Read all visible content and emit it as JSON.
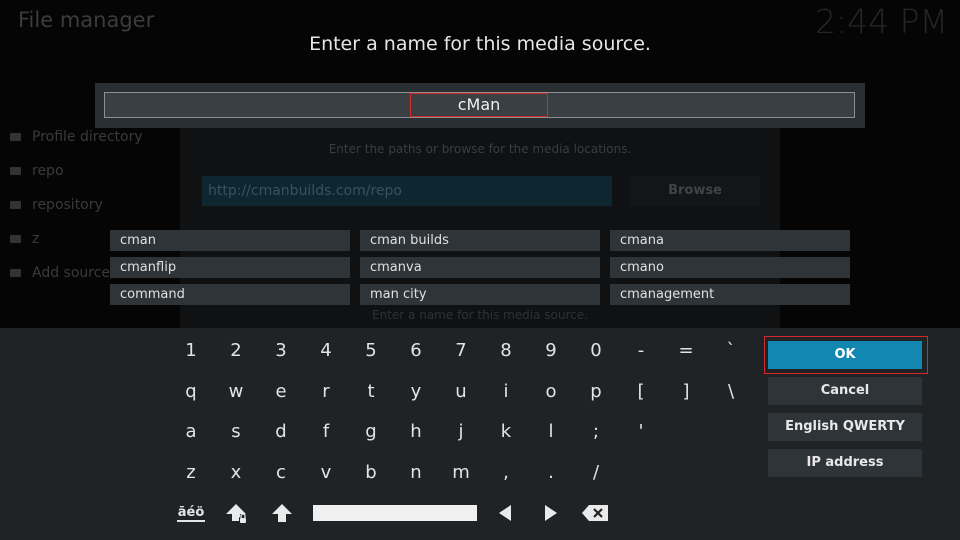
{
  "background": {
    "title": "File manager",
    "clock": "2:44 PM",
    "sources": [
      "Profile directory",
      "repo",
      "repository",
      "z",
      "Add source"
    ],
    "hint": "Enter the paths or browse for the media locations.",
    "url": "http://cmanbuilds.com/repo",
    "browse": "Browse",
    "name_hint": "Enter a name for this media source."
  },
  "dialog": {
    "heading": "Enter a name for this media source.",
    "input_value": "cMan",
    "suggestions": [
      "cman",
      "cman builds",
      "cmana",
      "cmanflip",
      "cmanva",
      "cmano",
      "command",
      "man city",
      "cmanagement"
    ]
  },
  "keyboard": {
    "rows": [
      [
        "1",
        "2",
        "3",
        "4",
        "5",
        "6",
        "7",
        "8",
        "9",
        "0",
        "-",
        "=",
        "`"
      ],
      [
        "q",
        "w",
        "e",
        "r",
        "t",
        "y",
        "u",
        "i",
        "o",
        "p",
        "[",
        "]",
        "\\"
      ],
      [
        "a",
        "s",
        "d",
        "f",
        "g",
        "h",
        "j",
        "k",
        "l",
        ";",
        "'"
      ],
      [
        "z",
        "x",
        "c",
        "v",
        "b",
        "n",
        "m",
        ",",
        ".",
        "/"
      ]
    ],
    "symbols_label": "āéö",
    "icons": [
      "caps-lock-icon",
      "shift-icon",
      "arrow-left-icon",
      "arrow-right-icon",
      "backspace-icon"
    ]
  },
  "side_buttons": {
    "ok": "OK",
    "cancel": "Cancel",
    "layout": "English QWERTY",
    "ip": "IP address"
  },
  "colors": {
    "accent": "#1287b1",
    "focus_outline": "#d42a2a",
    "keyboard_bg": "#1f2326"
  }
}
